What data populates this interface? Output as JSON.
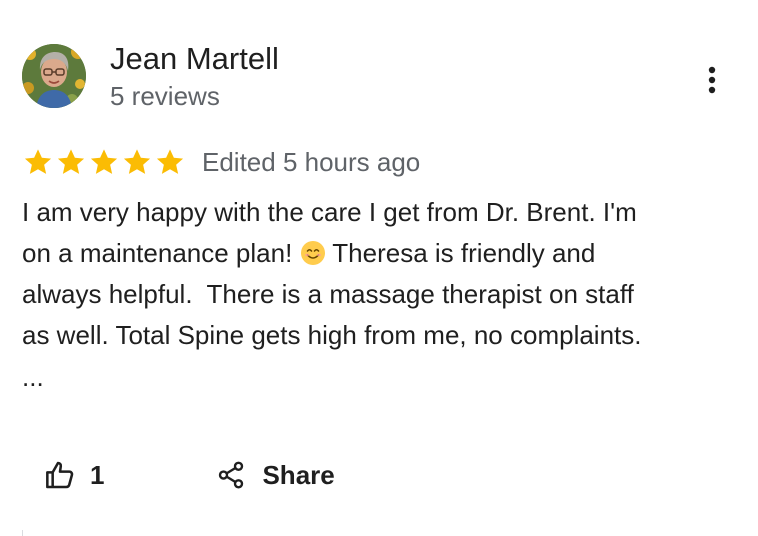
{
  "reviewer": {
    "name": "Jean Martell",
    "reviews_count": "5 reviews",
    "avatar_icon": "profile-photo"
  },
  "rating": {
    "stars": 5,
    "max_stars": 5,
    "star_color": "#fbbc04",
    "edited": "Edited 5 hours ago"
  },
  "review": {
    "lines": [
      "I am very happy with the care I get from Dr. Brent. I'm",
      "on a maintenance plan! ",
      " Theresa is friendly and",
      "always helpful.  There is a massage therapist on staff",
      "as well. Total Spine gets high from me, no complaints."
    ],
    "emoji": "smiling-face",
    "more": "..."
  },
  "actions": {
    "like_icon": "thumbs-up-icon",
    "like_count": "1",
    "share_icon": "share-icon",
    "share_label": "Share",
    "more_icon": "three-dots-vertical-icon"
  }
}
